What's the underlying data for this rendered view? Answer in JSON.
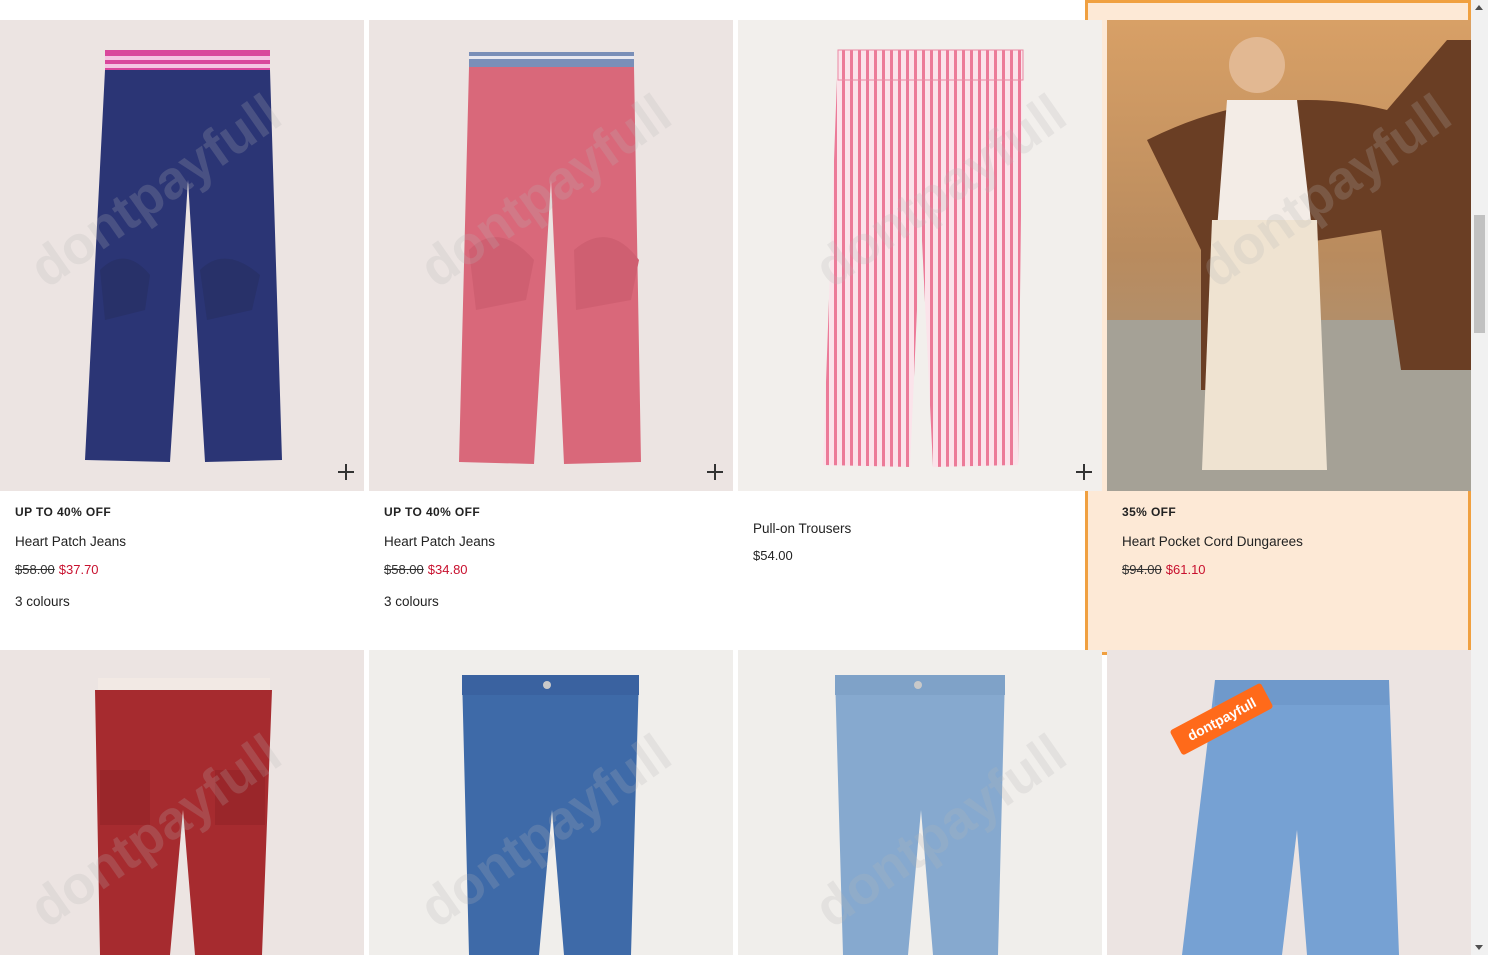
{
  "products": [
    {
      "promo": "UP TO 40% OFF",
      "name": "Heart Patch Jeans",
      "was": "$58.00",
      "now": "$37.70",
      "colours": "3 colours",
      "image": "navy cord jeans with heart patches",
      "bg": "#ece4e2"
    },
    {
      "promo": "UP TO 40% OFF",
      "name": "Heart Patch Jeans",
      "was": "$58.00",
      "now": "$34.80",
      "colours": "3 colours",
      "image": "pink cord jeans with heart patches",
      "bg": "#ece4e2"
    },
    {
      "promo": "",
      "name": "Pull-on Trousers",
      "price": "$54.00",
      "image": "pink striped pull-on trousers",
      "bg": "#f2efec"
    },
    {
      "promo": "35% OFF",
      "name": "Heart Pocket Cord Dungarees",
      "was": "$94.00",
      "now": "$61.10",
      "image": "girl with horse wearing cream dungarees",
      "bg": "#7a5a3a"
    },
    {
      "image": "red cord flared trousers",
      "bg": "#ece4e2"
    },
    {
      "image": "mid blue skinny jeans",
      "bg": "#f0eeeb"
    },
    {
      "image": "light blue skinny jeans",
      "bg": "#f0eeeb"
    },
    {
      "image": "light blue relaxed jeans",
      "bg": "#ece4e2"
    }
  ],
  "watermark": "dontpayfull",
  "badge": "dontpayfull",
  "colors": {
    "highlight_border": "#f0a040",
    "highlight_bg": "#fde9d6",
    "sale_red": "#c8102e"
  },
  "icons": [
    "plus-icon",
    "scroll-up-arrow-icon",
    "scroll-down-arrow-icon"
  ]
}
